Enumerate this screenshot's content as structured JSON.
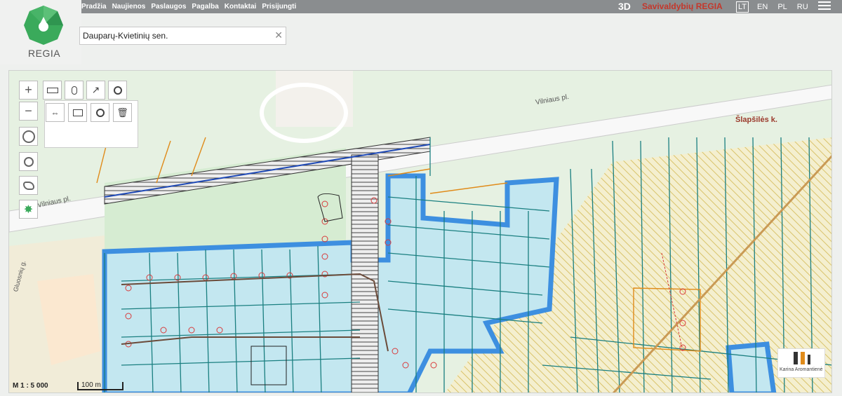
{
  "brand": {
    "logo_text": "REGIA",
    "title": "Savivaldybių REGIA",
    "mode_3d": "3D",
    "logo_color": "#3aaa5b"
  },
  "nav": {
    "items": [
      "Pradžia",
      "Naujienos",
      "Paslaugos",
      "Pagalba",
      "Kontaktai",
      "Prisijungti"
    ]
  },
  "languages": {
    "items": [
      "LT",
      "EN",
      "PL",
      "RU"
    ],
    "active": "LT"
  },
  "search": {
    "value": "Dauparų-Kvietinių sen."
  },
  "map": {
    "labels": {
      "road1": "Vilniaus pl.",
      "road2": "Vilniaus pl.",
      "village": "Šlapšilės k.",
      "street": "Gluosnių g."
    },
    "scale": {
      "ratio": "M 1 : 5 000",
      "bar": "100 m"
    },
    "watermark": "Karina Aromantienė",
    "colors": {
      "parcel_line": "#1a7f80",
      "zone_blue": "#3d8fe0",
      "hatch_yellow": "#d9c36b",
      "network_red": "#d83a3a",
      "road_hatch": "#444"
    }
  },
  "tools": {
    "zoom_in": "+",
    "zoom_out": "−"
  }
}
